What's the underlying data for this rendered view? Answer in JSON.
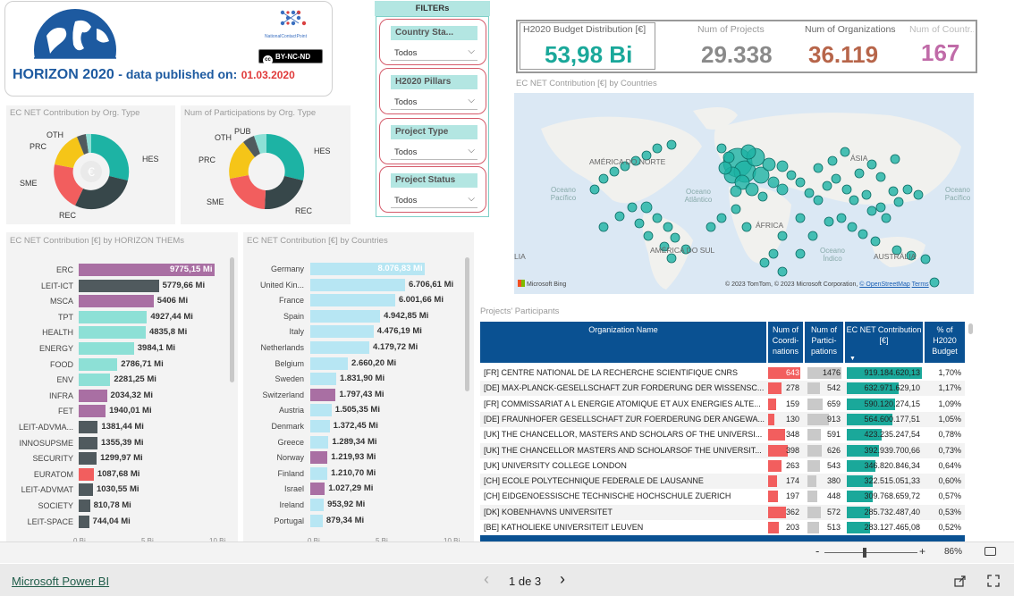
{
  "header": {
    "title": "HORIZON 2020",
    "subtitle": "- data published on:",
    "date": "01.03.2020",
    "ncp_text": "NationalContactPoint",
    "license": "BY-NC-ND"
  },
  "filters": {
    "title": "FILTERs",
    "items": [
      {
        "label": "Country Sta...",
        "value": "Todos"
      },
      {
        "label": "H2020 Pillars",
        "value": "Todos"
      },
      {
        "label": "Project Type",
        "value": "Todos"
      },
      {
        "label": "Project Status",
        "value": "Todos"
      }
    ]
  },
  "kpis": [
    {
      "label": "H2020 Budget Distribution [€]",
      "value": "53,98 Bi",
      "color": "#1aa89a"
    },
    {
      "label": "Num of Projects",
      "value": "29.338",
      "color": "#8a8a8a"
    },
    {
      "label": "Num of Organizations",
      "value": "36.119",
      "color": "#b7654a"
    },
    {
      "label": "Num of Countr...",
      "value": "167",
      "color": "#c06ba8"
    }
  ],
  "map": {
    "title": "EC NET Contribution [€] by Countries",
    "labels": {
      "na": "AMÉRICA DO NORTE",
      "asia": "ÁSIA",
      "sa": "AMÉRICA DO SUL",
      "au": "AUSTRÁLIA",
      "africa": "ÁFRICA",
      "pacific": "Oceano Pacífico",
      "atlantic": "Oceano Atlântico",
      "indian": "Oceano Índico",
      "pacific_e": "Oceano Pacífico",
      "lia": "LIA"
    },
    "bing": "Microsoft Bing",
    "copyright": "© 2023 TomTom, © 2023 Microsoft Corporation,",
    "osm": "© OpenStreetMap",
    "terms": "Terms"
  },
  "donut1": {
    "title": "EC NET Contribution by Org. Type",
    "center_icon": "€",
    "labels": {
      "oth": "OTH",
      "prc": "PRC",
      "sme": "SME",
      "rec": "REC",
      "hes": "HES"
    }
  },
  "donut2": {
    "title": "Num of Participations by Org. Type",
    "labels": {
      "oth": "OTH",
      "pub": "PUB",
      "prc": "PRC",
      "sme": "SME",
      "rec": "REC",
      "hes": "HES"
    }
  },
  "themes_chart": {
    "title": "EC NET Contribution [€] by HORIZON THEMs",
    "axis_ticks": [
      "0 Bi",
      "5 Bi",
      "10 Bi"
    ]
  },
  "countries_chart": {
    "title": "EC NET Contribution [€] by Countries",
    "axis_ticks": [
      "0 Bi",
      "5 Bi",
      "10 Bi"
    ]
  },
  "chart_data": [
    {
      "type": "bar",
      "title": "EC NET Contribution [€] by HORIZON THEMs",
      "categories": [
        "ERC",
        "LEIT-ICT",
        "MSCA",
        "TPT",
        "HEALTH",
        "ENERGY",
        "FOOD",
        "ENV",
        "INFRA",
        "FET",
        "LEIT-ADVMA...",
        "INNOSUPSME",
        "SECURITY",
        "EURATOM",
        "LEIT-ADVMAT",
        "SOCIETY",
        "LEIT-SPACE"
      ],
      "values": [
        9775.15,
        5779.66,
        5406,
        4927.44,
        4835.8,
        3984.1,
        2786.71,
        2281.25,
        2034.32,
        1940.01,
        1381.44,
        1355.39,
        1299.97,
        1087.68,
        1030.55,
        810.78,
        744.04
      ],
      "labels": [
        "9775,15 Mi",
        "5779,66 Mi",
        "5406 Mi",
        "4927,44 Mi",
        "4835,8 Mi",
        "3984,1 Mi",
        "2786,71 Mi",
        "2281,25 Mi",
        "2034,32 Mi",
        "1940,01 Mi",
        "1381,44 Mi",
        "1355,39 Mi",
        "1299,97 Mi",
        "1087,68 Mi",
        "1030,55 Mi",
        "810,78 Mi",
        "744,04 Mi"
      ],
      "colors": [
        "#a96fa3",
        "#505a5e",
        "#a96fa3",
        "#8de0d6",
        "#8de0d6",
        "#8de0d6",
        "#8de0d6",
        "#8de0d6",
        "#a96fa3",
        "#a96fa3",
        "#505a5e",
        "#505a5e",
        "#505a5e",
        "#f25e5e",
        "#505a5e",
        "#505a5e",
        "#505a5e"
      ],
      "xlim": [
        0,
        10000
      ]
    },
    {
      "type": "bar",
      "title": "EC NET Contribution [€] by Countries",
      "categories": [
        "Germany",
        "United Kin...",
        "France",
        "Spain",
        "Italy",
        "Netherlands",
        "Belgium",
        "Sweden",
        "Switzerland",
        "Austria",
        "Denmark",
        "Greece",
        "Norway",
        "Finland",
        "Israel",
        "Ireland",
        "Portugal"
      ],
      "values": [
        8076.83,
        6706.61,
        6001.66,
        4942.85,
        4476.19,
        4179.72,
        2660.2,
        1831.9,
        1797.43,
        1505.35,
        1372.45,
        1289.34,
        1219.93,
        1210.7,
        1027.29,
        953.92,
        879.34
      ],
      "labels": [
        "8.076,83 Mi",
        "6.706,61 Mi",
        "6.001,66 Mi",
        "4.942,85 Mi",
        "4.476,19 Mi",
        "4.179,72 Mi",
        "2.660,20 Mi",
        "1.831,90 Mi",
        "1.797,43 Mi",
        "1.505,35 Mi",
        "1.372,45 Mi",
        "1.289,34 Mi",
        "1.219,93 Mi",
        "1.210,70 Mi",
        "1.027,29 Mi",
        "953,92 Mi",
        "879,34 Mi"
      ],
      "colors": [
        "#b7e6f3",
        "#b7e6f3",
        "#b7e6f3",
        "#b7e6f3",
        "#b7e6f3",
        "#b7e6f3",
        "#b7e6f3",
        "#b7e6f3",
        "#a96fa3",
        "#b7e6f3",
        "#b7e6f3",
        "#b7e6f3",
        "#a96fa3",
        "#b7e6f3",
        "#a96fa3",
        "#b7e6f3",
        "#b7e6f3"
      ],
      "xlim": [
        0,
        10000
      ]
    }
  ],
  "table": {
    "title": "Projects' Participants",
    "headers": [
      "Organization Name",
      "Num of Coordi-nations",
      "Num of Partici-pations",
      "EC NET Contribution [€]",
      "% of H2020 Budget"
    ],
    "rows": [
      {
        "name": "[FR] CENTRE NATIONAL DE LA RECHERCHE SCIENTIFIQUE CNRS",
        "coord": 643,
        "part": 1476,
        "contrib": "919.184.620,13",
        "pct": "1,70%",
        "coord_frac": 1.0,
        "part_frac": 1.0,
        "contrib_frac": 1.0
      },
      {
        "name": "[DE] MAX-PLANCK-GESELLSCHAFT ZUR FORDERUNG DER WISSENSC...",
        "coord": 278,
        "part": 542,
        "contrib": "632.971.629,10",
        "pct": "1,17%",
        "coord_frac": 0.43,
        "part_frac": 0.37,
        "contrib_frac": 0.69
      },
      {
        "name": "[FR] COMMISSARIAT A L ENERGIE ATOMIQUE ET AUX ENERGIES ALTE...",
        "coord": 159,
        "part": 659,
        "contrib": "590.120.274,15",
        "pct": "1,09%",
        "coord_frac": 0.25,
        "part_frac": 0.45,
        "contrib_frac": 0.64
      },
      {
        "name": "[DE] FRAUNHOFER GESELLSCHAFT ZUR FOERDERUNG DER ANGEWA...",
        "coord": 130,
        "part": 913,
        "contrib": "564.600.177,51",
        "pct": "1,05%",
        "coord_frac": 0.2,
        "part_frac": 0.62,
        "contrib_frac": 0.61
      },
      {
        "name": "[UK] THE CHANCELLOR, MASTERS AND SCHOLARS OF THE UNIVERSI...",
        "coord": 348,
        "part": 591,
        "contrib": "423.235.247,54",
        "pct": "0,78%",
        "coord_frac": 0.54,
        "part_frac": 0.4,
        "contrib_frac": 0.46
      },
      {
        "name": "[UK] THE CHANCELLOR MASTERS AND SCHOLARSOF THE UNIVERSIT...",
        "coord": 398,
        "part": 626,
        "contrib": "392.939.700,66",
        "pct": "0,73%",
        "coord_frac": 0.62,
        "part_frac": 0.42,
        "contrib_frac": 0.43
      },
      {
        "name": "[UK] UNIVERSITY COLLEGE LONDON",
        "coord": 263,
        "part": 543,
        "contrib": "346.820.846,34",
        "pct": "0,64%",
        "coord_frac": 0.41,
        "part_frac": 0.37,
        "contrib_frac": 0.38
      },
      {
        "name": "[CH] ECOLE POLYTECHNIQUE FEDERALE DE LAUSANNE",
        "coord": 174,
        "part": 380,
        "contrib": "322.515.051,33",
        "pct": "0,60%",
        "coord_frac": 0.27,
        "part_frac": 0.26,
        "contrib_frac": 0.35
      },
      {
        "name": "[CH] EIDGENOESSISCHE TECHNISCHE HOCHSCHULE ZUERICH",
        "coord": 197,
        "part": 448,
        "contrib": "309.768.659,72",
        "pct": "0,57%",
        "coord_frac": 0.31,
        "part_frac": 0.3,
        "contrib_frac": 0.34
      },
      {
        "name": "[DK] KOBENHAVNS UNIVERSITET",
        "coord": 362,
        "part": 572,
        "contrib": "285.732.487,40",
        "pct": "0,53%",
        "coord_frac": 0.56,
        "part_frac": 0.39,
        "contrib_frac": 0.31
      },
      {
        "name": "[BE] KATHOLIEKE UNIVERSITEIT LEUVEN",
        "coord": 203,
        "part": 513,
        "contrib": "283.127.465,08",
        "pct": "0,52%",
        "coord_frac": 0.32,
        "part_frac": 0.35,
        "contrib_frac": 0.31
      }
    ]
  },
  "zoom": {
    "minus": "-",
    "plus": "+",
    "value": "86%",
    "level": 0.43
  },
  "footer": {
    "brand": "Microsoft Power BI",
    "page": "1 de 3",
    "prev": "‹",
    "next": "›"
  }
}
